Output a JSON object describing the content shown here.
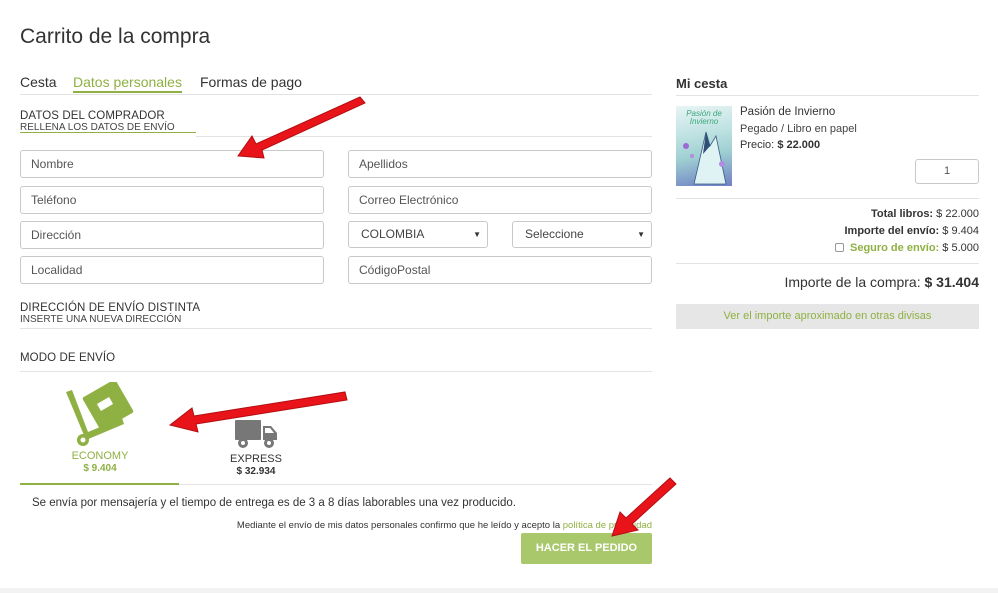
{
  "page_title": "Carrito de la compra",
  "tabs": [
    {
      "label": "Cesta"
    },
    {
      "label": "Datos personales"
    },
    {
      "label": "Formas de pago"
    }
  ],
  "buyer": {
    "title": "DATOS DEL COMPRADOR",
    "subtitle": "RELLENA LOS DATOS DE ENVÍO"
  },
  "fields": {
    "nombre": "Nombre",
    "apellidos": "Apellidos",
    "telefono": "Teléfono",
    "email": "Correo Electrónico",
    "direccion": "Dirección",
    "country": "COLOMBIA",
    "region": "Seleccione",
    "localidad": "Localidad",
    "postal": "CódigoPostal"
  },
  "alt_shipping": {
    "title": "DIRECCIÓN DE ENVÍO DISTINTA",
    "subtitle": "INSERTE UNA NUEVA DIRECCIÓN"
  },
  "shipping_mode": {
    "title": "MODO DE ENVÍO",
    "options": [
      {
        "label": "ECONOMY",
        "price": "$ 9.404"
      },
      {
        "label": "EXPRESS",
        "price": "$ 32.934"
      }
    ],
    "selected": "ECONOMY"
  },
  "delivery_note": "Se envía por mensajería y el tiempo de entrega es de 3 a 8 días laborables una vez producido.",
  "privacy": {
    "text": "Mediante el envío de mis datos personales confirmo que he leído y acepto la",
    "link": "política de privacidad"
  },
  "order_button": "HACER EL PEDIDO",
  "basket": {
    "title": "Mi cesta",
    "item": {
      "cover_text": "Pasión de Invierno",
      "title": "Pasión de Invierno",
      "format": "Pegado / Libro en papel",
      "price_label": "Precio:",
      "price": "$ 22.000",
      "qty": "1"
    },
    "totals": {
      "books_label": "Total libros:",
      "books_value": "$ 22.000",
      "shipping_label": "Importe del envío:",
      "shipping_value": "$ 9.404",
      "insurance_label": "Seguro de envío:",
      "insurance_value": "$ 5.000"
    },
    "grand_label": "Importe de la compra:",
    "grand_value": "$ 31.404",
    "currency_button": "Ver el importe aproximado en otras divisas"
  },
  "colors": {
    "accent": "#8fb042",
    "annotation": "#e8141a"
  }
}
